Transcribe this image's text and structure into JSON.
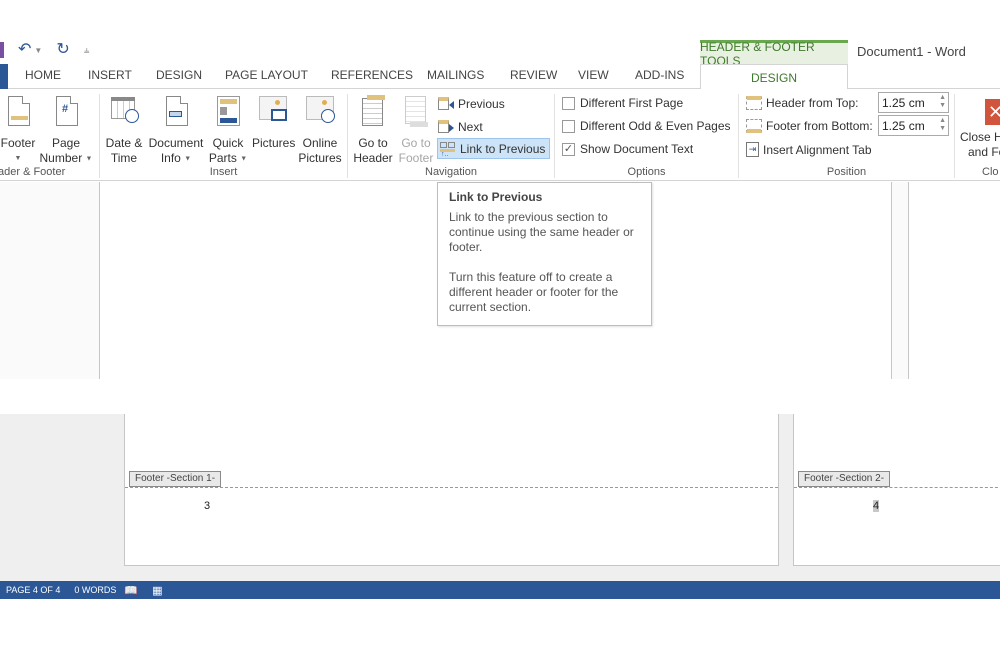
{
  "window": {
    "title": "Document1 - Word",
    "contextual_tab_group": "HEADER & FOOTER TOOLS",
    "accent_color": "#2b5797",
    "contextual_color": "#6aa84f"
  },
  "quick_access": {
    "undo_icon": "undo-icon",
    "redo_icon": "redo-icon",
    "customize_icon": "customize-qat-icon"
  },
  "tabs": [
    {
      "label": "HOME"
    },
    {
      "label": "INSERT"
    },
    {
      "label": "DESIGN"
    },
    {
      "label": "PAGE LAYOUT"
    },
    {
      "label": "REFERENCES"
    },
    {
      "label": "MAILINGS"
    },
    {
      "label": "REVIEW"
    },
    {
      "label": "VIEW"
    },
    {
      "label": "ADD-INS"
    },
    {
      "label": "DESIGN",
      "active": true
    }
  ],
  "ribbon": {
    "header_footer": {
      "label": "ader & Footer",
      "footer": "Footer",
      "page_number_1": "Page",
      "page_number_2": "Number"
    },
    "insert": {
      "label": "Insert",
      "date_time_1": "Date &",
      "date_time_2": "Time",
      "doc_info_1": "Document",
      "doc_info_2": "Info",
      "quick_parts_1": "Quick",
      "quick_parts_2": "Parts",
      "pictures": "Pictures",
      "online_pictures_1": "Online",
      "online_pictures_2": "Pictures"
    },
    "navigation": {
      "label": "Navigation",
      "go_to_header_1": "Go to",
      "go_to_header_2": "Header",
      "go_to_footer_1": "Go to",
      "go_to_footer_2": "Footer",
      "previous": "Previous",
      "next": "Next",
      "link_to_previous": "Link to Previous"
    },
    "options": {
      "label": "Options",
      "different_first_page": {
        "label": "Different First Page",
        "checked": false
      },
      "different_odd_even": {
        "label": "Different Odd & Even Pages",
        "checked": false
      },
      "show_document_text": {
        "label": "Show Document Text",
        "checked": true
      }
    },
    "position": {
      "label": "Position",
      "header_from_top": {
        "label": "Header from Top:",
        "value": "1.25 cm"
      },
      "footer_from_bottom": {
        "label": "Footer from Bottom:",
        "value": "1.25 cm"
      },
      "insert_alignment_tab": "Insert Alignment Tab"
    },
    "close": {
      "label": "Clo",
      "close_1": "Close H",
      "close_2": "and Fo"
    }
  },
  "tooltip": {
    "title": "Link to Previous",
    "paragraph1": "Link to the previous section to continue using the same header or footer.",
    "paragraph2": "Turn this feature off to create a different header or footer for the current section."
  },
  "pages": [
    {
      "footer_tag": "Footer -Section 1-",
      "page_number": "3"
    },
    {
      "footer_tag": "Footer -Section 2-",
      "page_number": "4",
      "selected": true
    }
  ],
  "status_bar": {
    "page": "PAGE 4 OF 4",
    "words": "0 WORDS",
    "proofing_icon": "proofing-icon",
    "macro_icon": "macro-record-icon"
  }
}
